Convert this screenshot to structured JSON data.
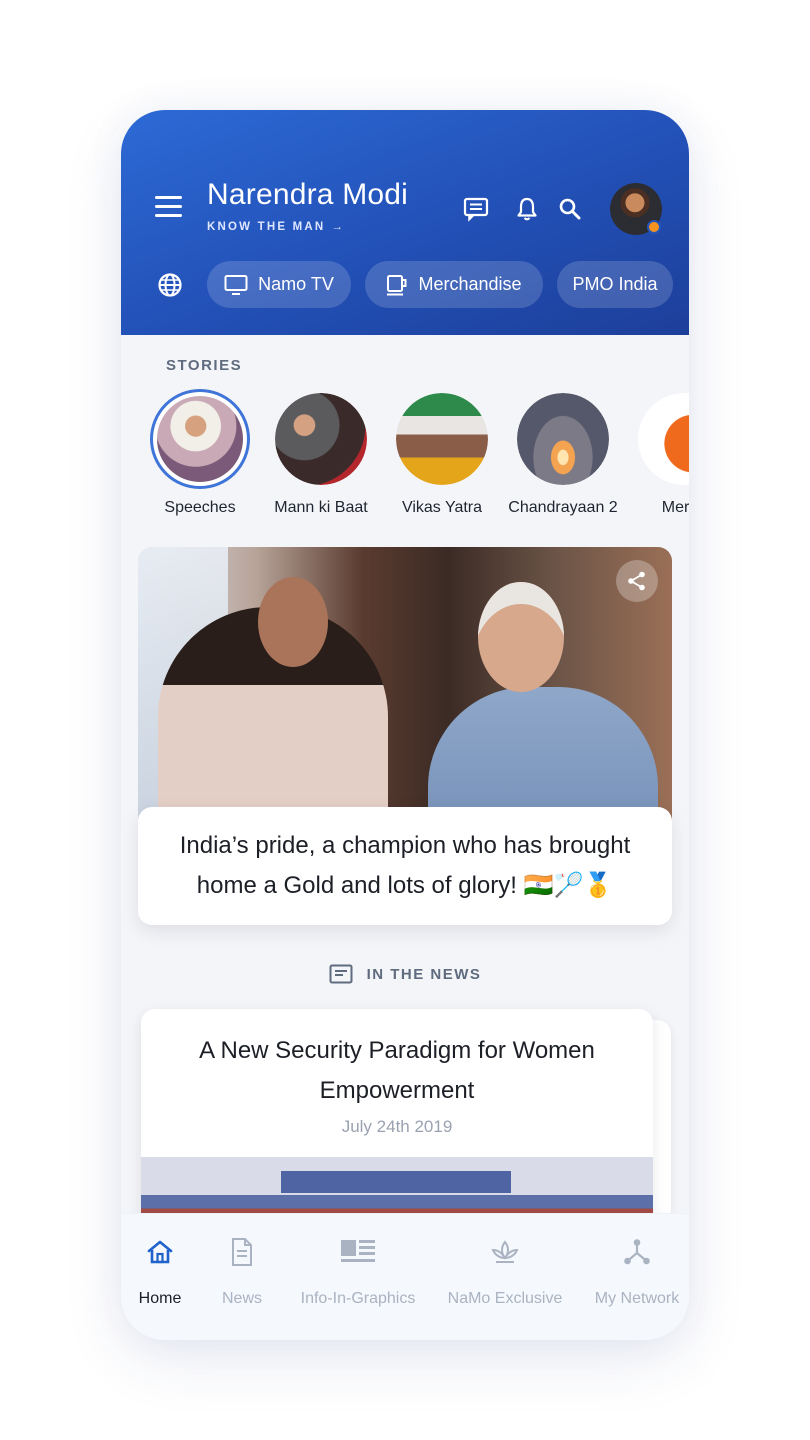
{
  "header": {
    "title": "Narendra Modi",
    "subtitle": "KNOW THE MAN",
    "subtitle_arrow": "→",
    "icons": [
      "menu-icon",
      "message-icon",
      "bell-icon",
      "search-icon"
    ],
    "chips": [
      {
        "label": "Namo TV",
        "icon": "tv-icon"
      },
      {
        "label": "Merchandise",
        "icon": "mug-icon"
      },
      {
        "label": "PMO India",
        "icon": ""
      }
    ]
  },
  "stories": {
    "heading": "STORIES",
    "items": [
      {
        "label": "Speeches",
        "active": true
      },
      {
        "label": "Mann ki Baat",
        "active": false
      },
      {
        "label": "Vikas Yatra",
        "active": false
      },
      {
        "label": "Chandrayaan 2",
        "active": false
      },
      {
        "label": "Merch",
        "active": false
      }
    ]
  },
  "feature": {
    "caption": "India’s pride, a champion who has brought home a Gold and lots of glory! 🇮🇳🏸🥇"
  },
  "news": {
    "heading": "IN THE NEWS",
    "card_title": "A New Security Paradigm for Women Empowerment",
    "card_date": "July 24th 2019"
  },
  "bottom_nav": [
    {
      "label": "Home",
      "icon": "home-icon",
      "active": true
    },
    {
      "label": "News",
      "icon": "document-icon",
      "active": false
    },
    {
      "label": "Info-In-Graphics",
      "icon": "infographic-icon",
      "active": false
    },
    {
      "label": "NaMo Exclusive",
      "icon": "lotus-icon",
      "active": false
    },
    {
      "label": "My Network",
      "icon": "network-icon",
      "active": false
    }
  ],
  "colors": {
    "header_gradient_start": "#2d6ad6",
    "header_gradient_end": "#1d3f9a",
    "accent_blue": "#1f62c9",
    "notification_dot": "#f7931e"
  }
}
